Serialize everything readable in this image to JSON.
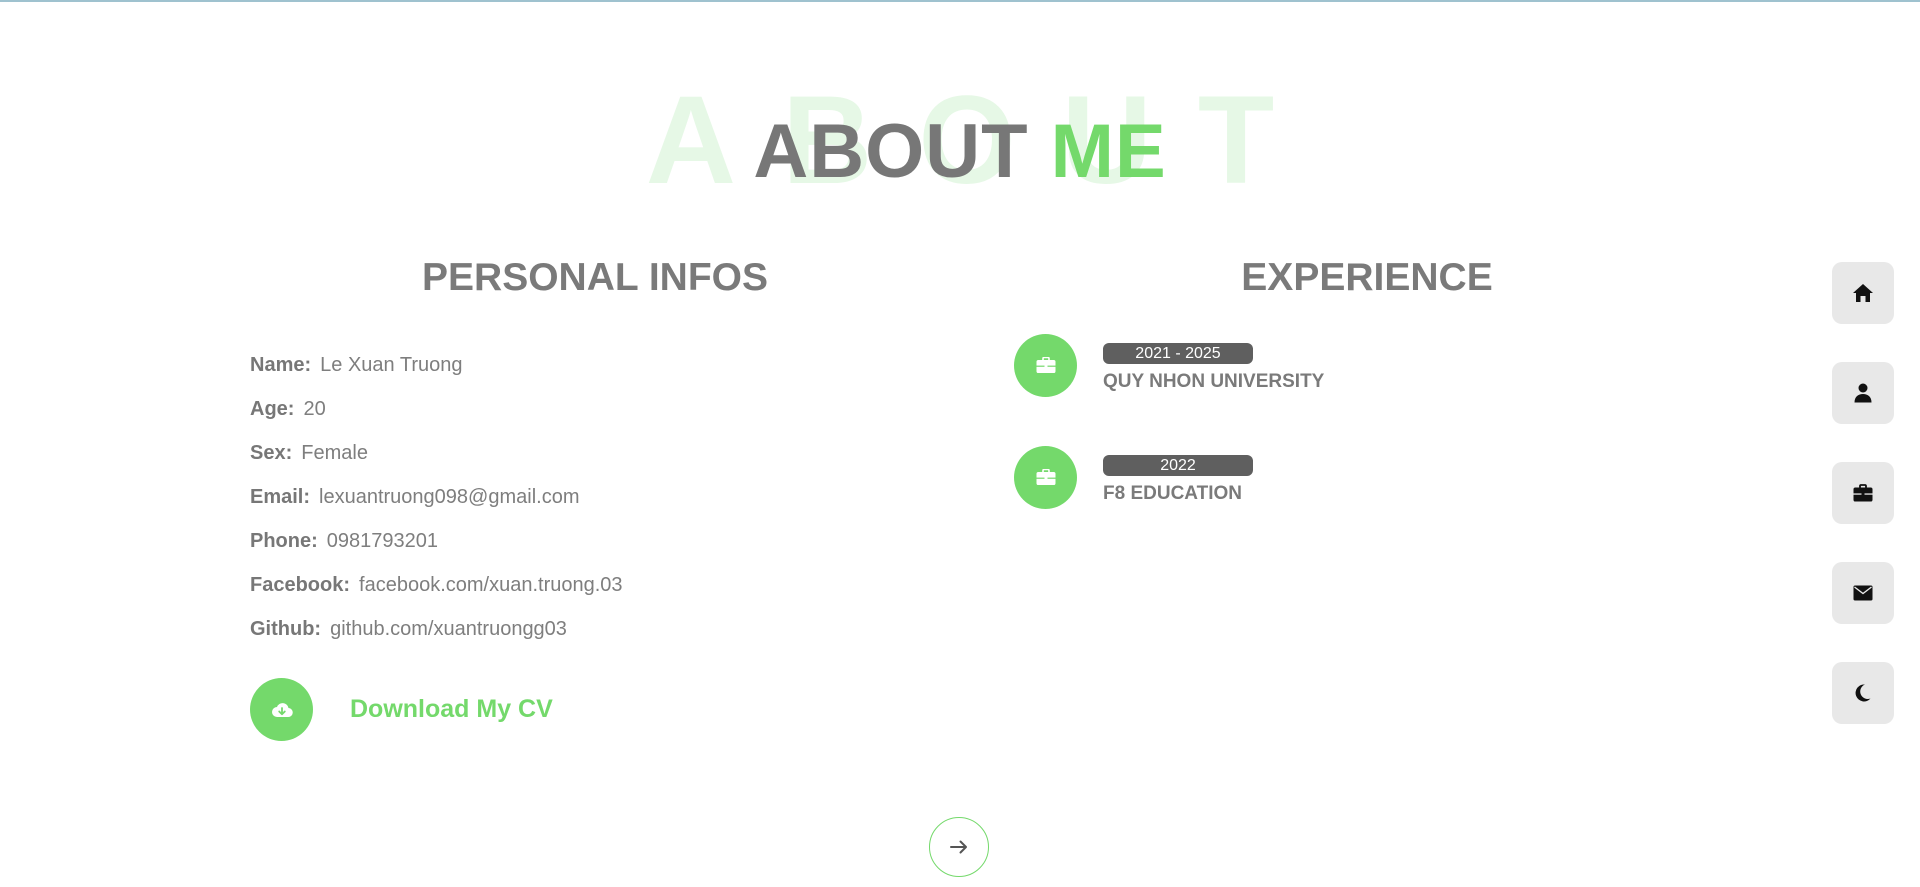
{
  "page": {
    "background_word": "ABOUT",
    "title_main": "ABOUT",
    "title_accent": "ME",
    "accent_color": "#74d96b",
    "text_color": "#777777"
  },
  "personal": {
    "title": "PERSONAL INFOS",
    "fields": [
      {
        "key": "Name:",
        "value": "Le Xuan Truong"
      },
      {
        "key": "Age:",
        "value": "20"
      },
      {
        "key": "Sex:",
        "value": "Female"
      },
      {
        "key": "Email:",
        "value": "lexuantruong098@gmail.com"
      },
      {
        "key": "Phone:",
        "value": "0981793201"
      },
      {
        "key": "Facebook:",
        "value": "facebook.com/xuan.truong.03"
      },
      {
        "key": "Github:",
        "value": "github.com/xuantruongg03"
      }
    ],
    "download": {
      "label": "Download My CV",
      "icon": "cloud-download-icon"
    }
  },
  "experience": {
    "title": "EXPERIENCE",
    "items": [
      {
        "years": "2021 - 2025",
        "organization": "QUY NHON UNIVERSITY",
        "icon": "briefcase-icon"
      },
      {
        "years": "2022",
        "organization": "F8 EDUCATION",
        "icon": "briefcase-icon"
      }
    ]
  },
  "side_nav": [
    {
      "icon": "home-icon"
    },
    {
      "icon": "user-icon"
    },
    {
      "icon": "briefcase-icon"
    },
    {
      "icon": "envelope-icon"
    },
    {
      "icon": "moon-icon"
    }
  ],
  "next_button": {
    "icon": "arrow-right-icon"
  }
}
